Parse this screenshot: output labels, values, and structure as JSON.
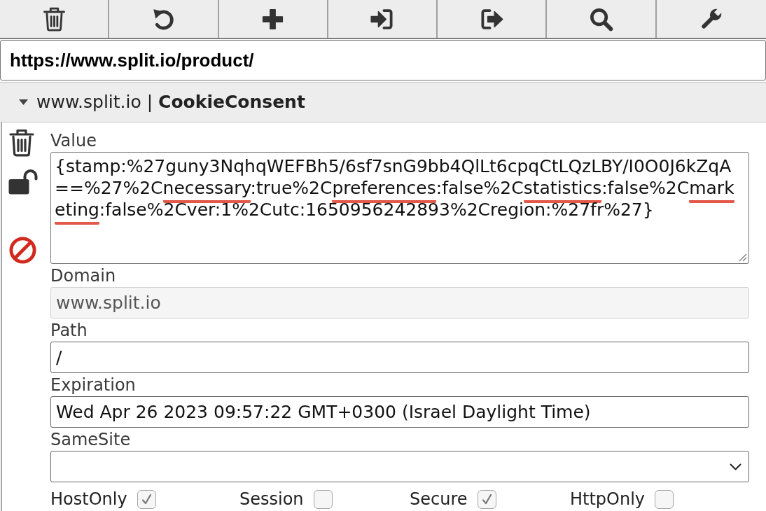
{
  "toolbar": [
    {
      "kind": "delete"
    },
    {
      "kind": "restore"
    },
    {
      "kind": "add"
    },
    {
      "kind": "import"
    },
    {
      "kind": "export"
    },
    {
      "kind": "search"
    },
    {
      "kind": "options"
    }
  ],
  "url": "https://www.split.io/product/",
  "header": {
    "title": "www.split.io | **CookieConsent**",
    "expanded": true
  },
  "side_actions": [
    {
      "kind": "delete"
    },
    {
      "kind": "unlocked"
    },
    {
      "kind": "block"
    }
  ],
  "value": {
    "label": "Value",
    "lines": [
      [
        {
          "text": "{stamp:%27guny3NqhqWEFBh5/6sf7snG9bb4QlLt6cpqCtLQzLBY/I0O0J6kZqA",
          "underlined": false
        }
      ],
      [
        {
          "text": "==%27%2C",
          "underlined": false
        },
        {
          "text": "necessary",
          "underlined": true
        },
        {
          "text": ":true%2C",
          "underlined": false
        },
        {
          "text": "preferences",
          "underlined": true
        },
        {
          "text": ":false%2C",
          "underlined": false
        },
        {
          "text": "statistics",
          "underlined": true
        },
        {
          "text": ":false%2C",
          "underlined": false
        },
        {
          "text": "mark",
          "underlined": true
        }
      ],
      [
        {
          "text": "eting",
          "underlined": true
        },
        {
          "text": ":false%2Cver:1%2Cutc:1650956242893%2Cregion:%27fr%27}",
          "underlined": false
        }
      ]
    ]
  },
  "fields": [
    {
      "kind": "text",
      "label": "Domain",
      "value": "www.split.io",
      "disabled": true
    },
    {
      "kind": "text",
      "label": "Path",
      "value": "/",
      "disabled": false
    },
    {
      "kind": "text",
      "label": "Expiration",
      "value": "Wed Apr 26 2023 09:57:22 GMT+0300 (Israel Daylight Time)",
      "disabled": false
    },
    {
      "kind": "select",
      "label": "SameSite",
      "disabled": false
    }
  ],
  "flags": [
    {
      "label": "HostOnly",
      "checked": true
    },
    {
      "label": "Session",
      "checked": false
    },
    {
      "label": "Secure",
      "checked": true
    },
    {
      "label": "HttpOnly",
      "checked": false
    }
  ]
}
